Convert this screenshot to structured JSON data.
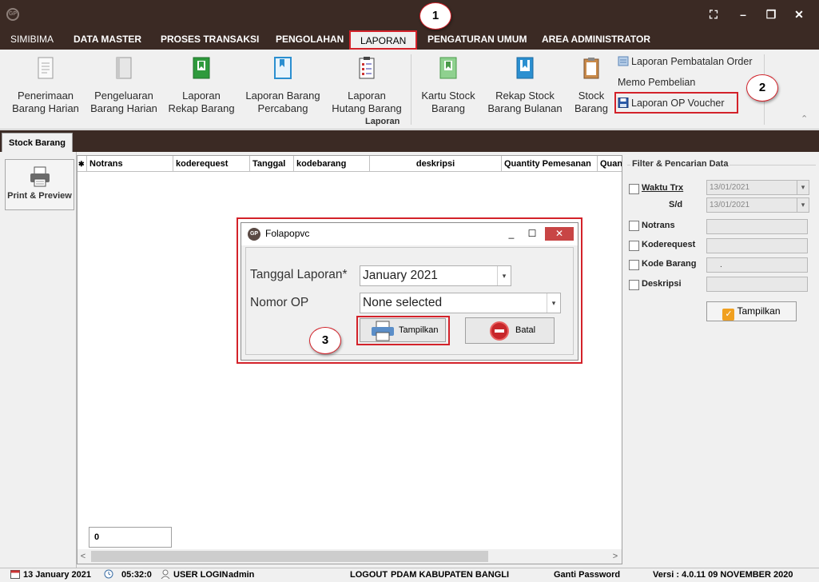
{
  "window": {
    "logo_text": "GP",
    "controls": {
      "restore": "⛶",
      "minimize": "–",
      "maximize": "❐",
      "close": "✕"
    }
  },
  "menu": {
    "items": [
      "SIMIBIMA",
      "DATA MASTER",
      "PROSES TRANSAKSI",
      "PENGOLAHAN",
      "LAPORAN",
      "PENGATURAN UMUM",
      "AREA ADMINISTRATOR"
    ],
    "active": "LAPORAN"
  },
  "ribbon": {
    "buttons": [
      {
        "line1": "Penerimaan",
        "line2": "Barang Harian",
        "icon": "document-icon"
      },
      {
        "line1": "Pengeluaran",
        "line2": "Barang Harian",
        "icon": "book-icon"
      },
      {
        "line1": "Laporan",
        "line2": "Rekap Barang",
        "icon": "green-book-icon"
      },
      {
        "line1": "Laporan Barang",
        "line2": "Percabang",
        "icon": "blue-book-icon"
      },
      {
        "line1": "Laporan",
        "line2": "Hutang Barang",
        "icon": "clipboard-list-icon"
      },
      {
        "line1": "Kartu Stock",
        "line2": "Barang",
        "icon": "green-book-icon"
      },
      {
        "line1": "Rekap Stock",
        "line2": "Barang Bulanan",
        "icon": "blue-book-icon"
      },
      {
        "line1": "Stock",
        "line2": "Barang",
        "icon": "clipboard-icon"
      }
    ],
    "group_label": "Laporan",
    "small_items": [
      "Laporan Pembatalan Order",
      "Memo Pembelian",
      "Laporan OP Voucher"
    ],
    "collapse_glyph": "⌃"
  },
  "tabs": {
    "active": "Stock Barang"
  },
  "left_panel": {
    "print_label": "Print & Preview"
  },
  "grid": {
    "row_marker": "✱",
    "columns": [
      "Notrans",
      "koderequest",
      "Tanggal",
      "kodebarang",
      "deskripsi",
      "Quantity Pemesanan",
      "Quan"
    ],
    "footer_count": "0",
    "scroll_left": "<",
    "scroll_right": ">"
  },
  "filter": {
    "title": "Filter & Pencarian Data",
    "waktu_label": "Waktu Trx",
    "waktu_from": "13/01/2021",
    "sd_label": "S/d",
    "waktu_to": "13/01/2021",
    "notrans_label": "Notrans",
    "koderequest_label": "Koderequest",
    "kode_barang_label": "Kode Barang",
    "kode_barang_value": ".",
    "deskripsi_label": "Deskripsi",
    "tampilkan_label": "Tampilkan",
    "dropdown_glyph": "▾"
  },
  "dialog": {
    "title": "Folapopvc",
    "logo_text": "GP",
    "controls": {
      "minimize": "_",
      "maximize": "☐",
      "close": "✕"
    },
    "tanggal_label": "Tanggal Laporan*",
    "tanggal_value": "January 2021",
    "nomor_label": "Nomor OP",
    "nomor_value": "None selected",
    "dropdown_glyph": "▾",
    "tampilkan_label": "Tampilkan",
    "batal_label": "Batal"
  },
  "callouts": [
    "1",
    "2",
    "3"
  ],
  "statusbar": {
    "date": "13 January 2021",
    "time": "05:32:0",
    "user_login_label": "USER LOGIN",
    "user": "admin",
    "logout": "LOGOUT",
    "org": "PDAM KABUPATEN BANGLI",
    "ganti_password": "Ganti Password",
    "version": "Versi : 4.0.11  09 NOVEMBER 2020"
  }
}
